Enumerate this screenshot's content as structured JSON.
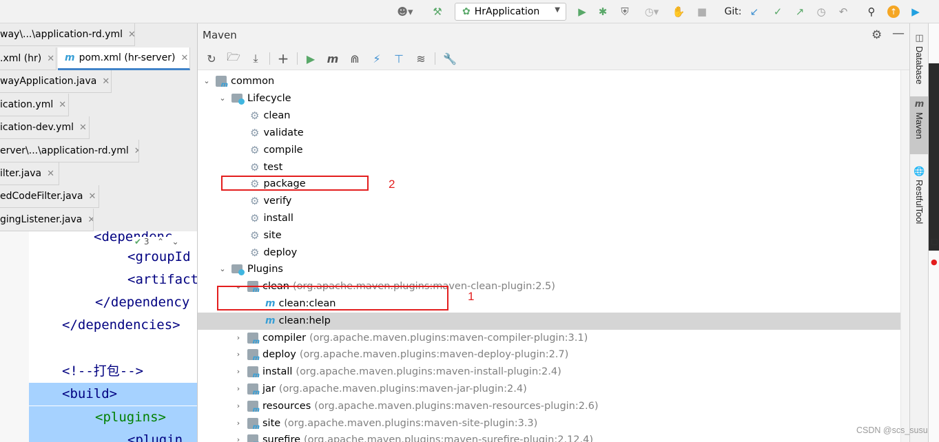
{
  "toolbar": {
    "run_config": "HrApplication",
    "git_label": "Git:"
  },
  "editor_tabs": [
    {
      "label": "way\\...\\application-rd.yml"
    },
    {
      "label": ".xml (hr)"
    },
    {
      "label": "pom.xml (hr-server)"
    },
    {
      "label": "wayApplication.java"
    },
    {
      "label": "ication.yml"
    },
    {
      "label": "ication-dev.yml"
    },
    {
      "label": "erver\\...\\application-rd.yml"
    },
    {
      "label": "ilter.java"
    },
    {
      "label": "edCodeFilter.java"
    },
    {
      "label": "gingListener.java"
    }
  ],
  "editor": {
    "hint_count": "3",
    "lines": [
      {
        "text": "<dependenc"
      },
      {
        "text": "<groupId"
      },
      {
        "text": "<artifact"
      },
      {
        "text": "</dependency"
      },
      {
        "text": "</dependencies>"
      },
      {
        "text": ""
      },
      {
        "text": "<!--打包-->"
      },
      {
        "text": "<build>"
      },
      {
        "text": "<plugins>"
      },
      {
        "text": "<plugin"
      }
    ]
  },
  "maven": {
    "title": "Maven",
    "tree": {
      "root": "common",
      "lifecycle_label": "Lifecycle",
      "lifecycle": [
        "clean",
        "validate",
        "compile",
        "test",
        "package",
        "verify",
        "install",
        "site",
        "deploy"
      ],
      "plugins_label": "Plugins",
      "clean_plugin": {
        "name": "clean",
        "artifact": "(org.apache.maven.plugins:maven-clean-plugin:2.5)"
      },
      "clean_goals": [
        "clean:clean",
        "clean:help"
      ],
      "plugins": [
        {
          "name": "compiler",
          "artifact": "(org.apache.maven.plugins:maven-compiler-plugin:3.1)"
        },
        {
          "name": "deploy",
          "artifact": "(org.apache.maven.plugins:maven-deploy-plugin:2.7)"
        },
        {
          "name": "install",
          "artifact": "(org.apache.maven.plugins:maven-install-plugin:2.4)"
        },
        {
          "name": "jar",
          "artifact": "(org.apache.maven.plugins:maven-jar-plugin:2.4)"
        },
        {
          "name": "resources",
          "artifact": "(org.apache.maven.plugins:maven-resources-plugin:2.6)"
        },
        {
          "name": "site",
          "artifact": "(org.apache.maven.plugins:maven-site-plugin:3.3)"
        },
        {
          "name": "surefire",
          "artifact": "(org.apache.maven.plugins:maven-surefire-plugin:2.12.4)"
        }
      ]
    },
    "annotations": {
      "label_1": "1",
      "label_2": "2"
    }
  },
  "right_tools": [
    {
      "label": "Database",
      "icon": "database-icon"
    },
    {
      "label": "Maven",
      "icon": "maven-icon"
    },
    {
      "label": "RestfulTool",
      "icon": "globe-icon"
    }
  ],
  "watermark": "CSDN @scs_susu",
  "colors": {
    "accent": "#4083c9",
    "annotation": "#e31d1d",
    "selection": "#d5d5d5",
    "code_selection": "#a6d2ff"
  }
}
